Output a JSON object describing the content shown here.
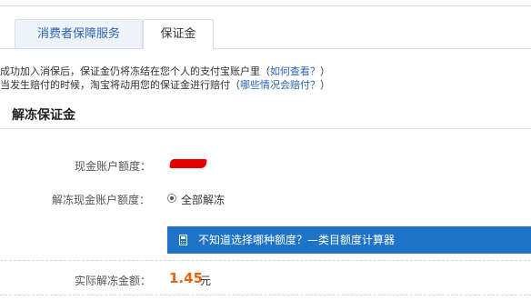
{
  "tabs": [
    {
      "label": "消费者保障服务",
      "active": false
    },
    {
      "label": "保证金",
      "active": true
    }
  ],
  "notes": {
    "line1_text": "成功加入消保后，保证金仍将冻结在您个人的支付宝账户里（",
    "line1_link": "如何查看？",
    "line1_end": "）",
    "line2_text": "当发生赔付的时候，淘宝将动用您的保证金进行赔付（",
    "line2_link": "哪些情况会赔付？",
    "line2_end": "）"
  },
  "section_title": "解冻保证金",
  "form": {
    "cash_label": "现金账户额度：",
    "unfreeze_label": "解冻现金账户额度：",
    "radio_option": "全部解冻",
    "calculator_link": "不知道选择哪种额度？—类目额度计算器",
    "actual_label": "实际解冻金额：",
    "actual_amount": "1.45",
    "actual_unit": "元"
  },
  "colors": {
    "link": "#2a65b3",
    "banner": "#1f73c6",
    "amount": "#e8620a",
    "redaction": "#e30000"
  }
}
